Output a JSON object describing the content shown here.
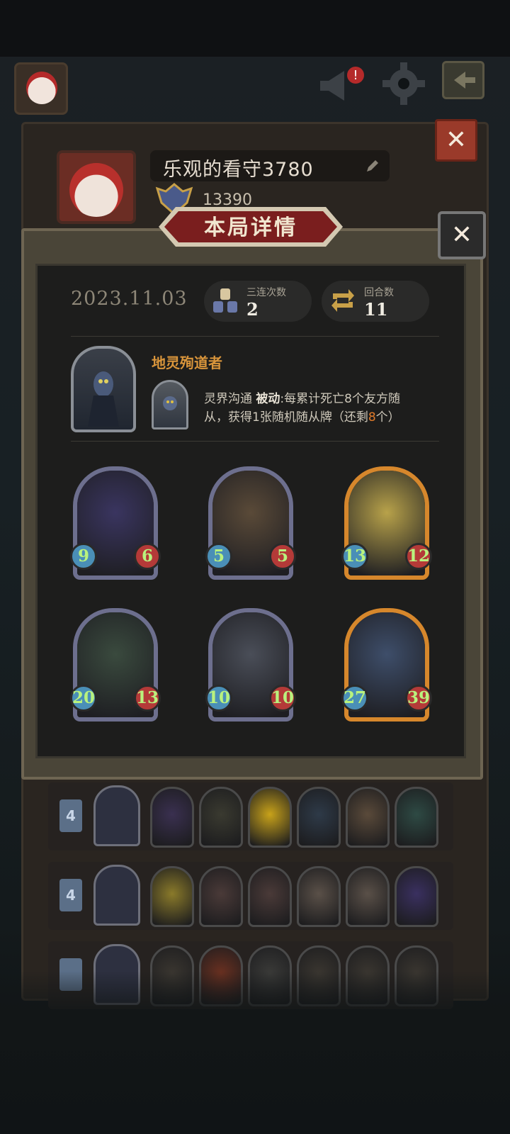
{
  "profile": {
    "name": "乐观的看守3780",
    "score": "13390"
  },
  "modal": {
    "title": "本局详情",
    "close_symbol": "✕",
    "date": "2023.11.03",
    "stats": [
      {
        "label": "三连次数",
        "value": "2",
        "icon": "triple-icon"
      },
      {
        "label": "回合数",
        "value": "11",
        "icon": "round-arrows-icon"
      }
    ],
    "hero": {
      "name": "地灵殉道者",
      "skill_name": "灵界沟通",
      "skill_type": "被动",
      "skill_desc_1": ":每累计死亡8个友方随",
      "skill_desc_2a": "从，获得1张随机随从牌（还剩",
      "skill_remaining": "8",
      "skill_desc_2b": "个）"
    },
    "cards": [
      {
        "name": "reaper",
        "attack": "9",
        "health": "6",
        "frame": "silver",
        "art_color": "#3a3560"
      },
      {
        "name": "scholar",
        "attack": "5",
        "health": "5",
        "frame": "silver",
        "art_color": "#5a4a38"
      },
      {
        "name": "robot",
        "attack": "13",
        "health": "12",
        "frame": "gold",
        "art_color": "#b8a24a"
      },
      {
        "name": "witch",
        "attack": "20",
        "health": "13",
        "frame": "silver",
        "art_color": "#3a4a3e"
      },
      {
        "name": "panther",
        "attack": "10",
        "health": "10",
        "frame": "silver",
        "art_color": "#4a4e58"
      },
      {
        "name": "pirate",
        "attack": "27",
        "health": "39",
        "frame": "gold",
        "art_color": "#3e4e6a"
      }
    ]
  },
  "background_close_symbol": "✕",
  "history": [
    {
      "rank": "4",
      "cards": [
        "#3a3050",
        "#3a3a30",
        "#c8a21a",
        "#2e3a48",
        "#5a4a3a",
        "#2e4a44"
      ]
    },
    {
      "rank": "4",
      "cards": [
        "#8a7a2a",
        "#4a3a38",
        "#4a3a38",
        "#5a5048",
        "#5a5048",
        "#3a3060"
      ]
    },
    {
      "rank": "",
      "cards": [
        "#3a3630",
        "#6a3020",
        "#3a3a38",
        "#3a3630",
        "#3a3630",
        "#3a3630"
      ]
    }
  ]
}
